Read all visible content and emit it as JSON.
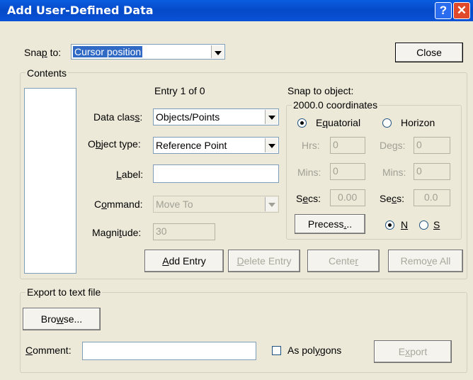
{
  "window": {
    "title": "Add User-Defined Data"
  },
  "snap": {
    "label": "Snap to:",
    "value": "Cursor position"
  },
  "close_label": "Close",
  "contents": {
    "label": "Contents",
    "entry_counter": "Entry 1 of 0",
    "data_class_label": "Data class:",
    "data_class_value": "Objects/Points",
    "object_type_label": "Object type:",
    "object_type_value": "Reference Point",
    "label_label": "Label:",
    "label_value": "",
    "command_label": "Command:",
    "command_value": "Move To",
    "magnitude_label": "Magnitude:",
    "magnitude_value": "30"
  },
  "snap_object": {
    "label": "Snap to object:",
    "coords_label": "2000.0 coordinates",
    "equatorial_label": "Equatorial",
    "horizon_label": "Horizon",
    "hrs_label": "Hrs:",
    "hrs_value": "0",
    "degs_label": "Degs:",
    "degs_value": "0",
    "mins1_label": "Mins:",
    "mins1_value": "0",
    "mins2_label": "Mins:",
    "mins2_value": "0",
    "secs1_label": "Secs:",
    "secs1_value": "0.00",
    "secs2_label": "Secs:",
    "secs2_value": "0.0",
    "precess_label": "Precess...",
    "n_label": "N",
    "s_label": "S"
  },
  "actions": {
    "add_entry": "Add Entry",
    "delete_entry": "Delete Entry",
    "center": "Center",
    "remove_all": "Remove All"
  },
  "export": {
    "label": "Export to text file",
    "browse": "Browse...",
    "comment_label": "Comment:",
    "comment_value": "",
    "as_polygons": "As polygons",
    "export_btn": "Export"
  }
}
